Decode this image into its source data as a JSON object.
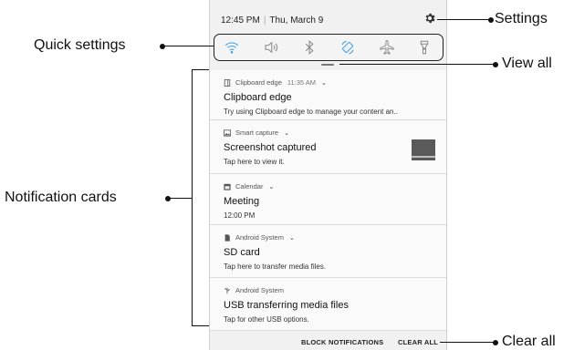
{
  "status_bar": {
    "time": "12:45 PM",
    "date": "Thu, March 9"
  },
  "quick_settings": [
    {
      "icon": "wifi-icon",
      "active": true
    },
    {
      "icon": "sound-icon",
      "active": false
    },
    {
      "icon": "bluetooth-icon",
      "active": false
    },
    {
      "icon": "auto-rotate-icon",
      "active": true
    },
    {
      "icon": "airplane-mode-icon",
      "active": false
    },
    {
      "icon": "flashlight-icon",
      "active": false
    }
  ],
  "notifications": [
    {
      "app": "Clipboard edge",
      "time": "11:35 AM",
      "title": "Clipboard edge",
      "body": "Try using Clipboard edge to manage your content an..",
      "icon": "clipboard-icon"
    },
    {
      "app": "Smart capture",
      "title": "Screenshot captured",
      "body": "Tap here to view it.",
      "icon": "image-icon"
    },
    {
      "app": "Calendar",
      "title": "Meeting",
      "body": "12:00 PM",
      "icon": "calendar-icon"
    },
    {
      "app": "Android System",
      "title": "SD card",
      "body": "Tap here to transfer media files.",
      "icon": "sd-card-icon"
    },
    {
      "app": "Android System",
      "title": "USB transferring media files",
      "body": "Tap for other USB options.",
      "icon": "usb-icon"
    }
  ],
  "footer": {
    "block": "BLOCK NOTIFICATIONS",
    "clear": "CLEAR ALL"
  },
  "callouts": {
    "settings": "Settings",
    "quick_settings": "Quick settings",
    "view_all": "View all",
    "notification_cards": "Notification cards",
    "clear_all": "Clear all"
  },
  "colors": {
    "accent": "#3aa0e8",
    "panel": "#f1f1f1",
    "card": "#fafafa"
  }
}
